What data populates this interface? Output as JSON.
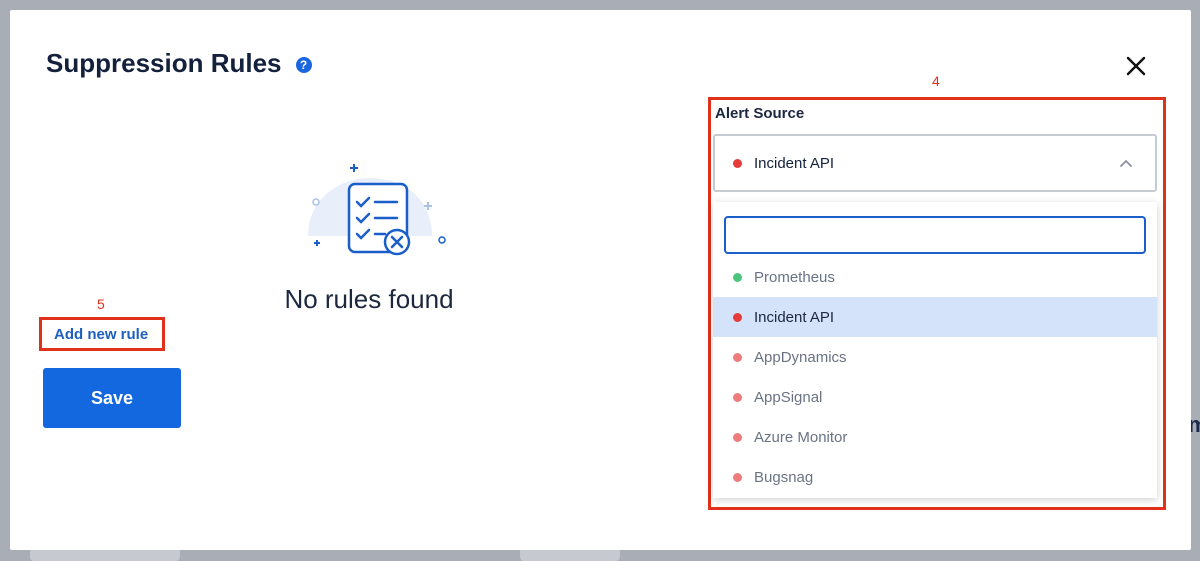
{
  "modal": {
    "title": "Suppression Rules",
    "help_glyph": "?",
    "empty_state_text": "No rules found",
    "add_rule_label": "Add new rule",
    "save_label": "Save"
  },
  "annotations": {
    "alert_source_marker": "4",
    "add_rule_marker": "5"
  },
  "alert_source": {
    "label": "Alert Source",
    "selected": "Incident API",
    "selected_color": "#e53b3b",
    "search_value": "",
    "options": [
      {
        "label": "Prometheus",
        "color": "#4cc47e",
        "selected": false
      },
      {
        "label": "Incident API",
        "color": "#e53b3b",
        "selected": true
      },
      {
        "label": "AppDynamics",
        "color": "#ef7a7a",
        "selected": false
      },
      {
        "label": "AppSignal",
        "color": "#ef7a7a",
        "selected": false
      },
      {
        "label": "Azure Monitor",
        "color": "#ef7a7a",
        "selected": false
      },
      {
        "label": "Bugsnag",
        "color": "#ef7a7a",
        "selected": false
      }
    ]
  },
  "colors": {
    "primary": "#1368e0",
    "annotation": "#e0311a",
    "selected_row": "#d5e3fa"
  },
  "icons": [
    "help-icon",
    "close-icon",
    "chevron-up-icon",
    "checklist-icon"
  ]
}
